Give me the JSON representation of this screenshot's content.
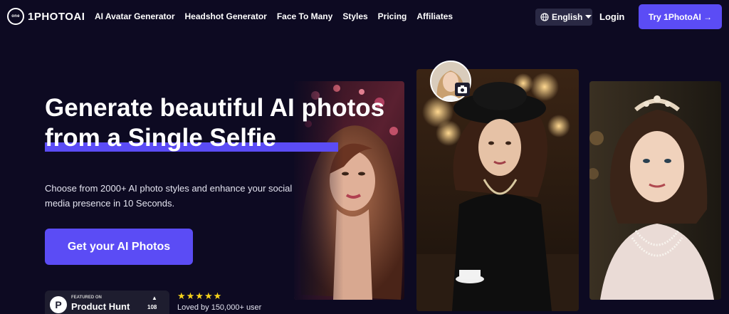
{
  "brand": {
    "mark": "one",
    "name": "1PHOTOAI"
  },
  "nav": {
    "links": [
      "AI Avatar Generator",
      "Headshot Generator",
      "Face To Many",
      "Styles",
      "Pricing",
      "Affiliates"
    ],
    "language": "English",
    "login": "Login",
    "try_button": "Try 1PhotoAI →"
  },
  "hero": {
    "headline_line1": "Generate beautiful AI photos",
    "headline_line2": "from a Single Selfie",
    "subtext": "Choose from 2000+ AI photo styles and enhance your social media presence in 10 Seconds.",
    "cta": "Get your AI Photos"
  },
  "product_hunt": {
    "badge_letter": "P",
    "featured": "FEATURED ON",
    "name": "Product Hunt",
    "arrow": "▲",
    "count": "108"
  },
  "rating": {
    "stars": "★★★★★",
    "loved": "Loved by 150,000+ user"
  },
  "colors": {
    "background": "#0d0a22",
    "accent": "#5b4cf5",
    "star": "#f6d21b"
  }
}
